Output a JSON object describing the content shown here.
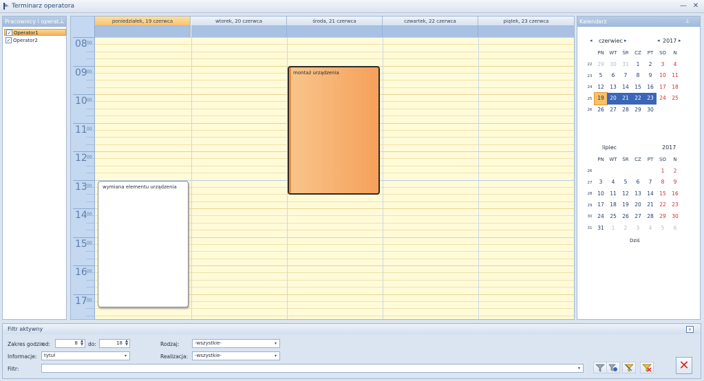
{
  "window": {
    "title": "Terminarz operatora",
    "min_glyph": "—",
    "close_glyph": "✕"
  },
  "left_panel": {
    "title": "Pracownicy i operat...",
    "pin_glyph": "⊥",
    "operators": [
      {
        "label": "Operator1",
        "checked": true,
        "selected": true
      },
      {
        "label": "Operator2",
        "checked": true,
        "selected": false
      }
    ]
  },
  "schedule": {
    "days": [
      {
        "label": "poniedziałek, 19 czerwca",
        "today": true
      },
      {
        "label": "wtorek, 20 czerwca",
        "today": false
      },
      {
        "label": "środa, 21 czerwca",
        "today": false
      },
      {
        "label": "czwartek, 22 czerwca",
        "today": false
      },
      {
        "label": "piątek, 23 czerwca",
        "today": false
      }
    ],
    "hours": [
      "08",
      "09",
      "10",
      "11",
      "12",
      "13",
      "14",
      "15",
      "16",
      "17"
    ],
    "minutes": "00",
    "appointments": [
      {
        "title": "montaż urządzenia",
        "day": "środa, 21 czerwca",
        "start": "09:00",
        "end": "13:30",
        "color": "#f6a864"
      },
      {
        "title": "wymiana elementu urządzenia",
        "day": "poniedziałek, 19 czerwca",
        "start": "13:00",
        "end": "17:30",
        "color": "#ffffff"
      }
    ]
  },
  "calendar": {
    "title": "Kalendarz",
    "weekday_headers": [
      "PN",
      "WT",
      "ŚR",
      "CZ",
      "PT",
      "SO",
      "N"
    ],
    "months": [
      {
        "name": "czerwiec",
        "year": "2017",
        "weeks": [
          "22",
          "23",
          "24",
          "25",
          "26"
        ],
        "days": [
          [
            "29",
            "30",
            "31",
            "1",
            "2",
            "3",
            "4"
          ],
          [
            "5",
            "6",
            "7",
            "8",
            "9",
            "10",
            "11"
          ],
          [
            "12",
            "13",
            "14",
            "15",
            "16",
            "17",
            "18"
          ],
          [
            "19",
            "20",
            "21",
            "22",
            "23",
            "24",
            "25"
          ],
          [
            "26",
            "27",
            "28",
            "29",
            "30",
            "",
            ""
          ]
        ],
        "leading_other": 3,
        "trailing_other": 0
      },
      {
        "name": "lipiec",
        "year": "2017",
        "weeks": [
          "26",
          "27",
          "28",
          "29",
          "30",
          "31"
        ],
        "days": [
          [
            "",
            "",
            "",
            "",
            "",
            "1",
            "2"
          ],
          [
            "3",
            "4",
            "5",
            "6",
            "7",
            "8",
            "9"
          ],
          [
            "10",
            "11",
            "12",
            "13",
            "14",
            "15",
            "16"
          ],
          [
            "17",
            "18",
            "19",
            "20",
            "21",
            "22",
            "23"
          ],
          [
            "24",
            "25",
            "26",
            "27",
            "28",
            "29",
            "30"
          ],
          [
            "31",
            "1",
            "2",
            "3",
            "4",
            "5",
            "6"
          ]
        ]
      }
    ],
    "today_label": "Dziś",
    "selected_range": [
      "19",
      "20",
      "21",
      "22",
      "23"
    ],
    "today_day": "19"
  },
  "filter": {
    "title": "Filtr aktywny",
    "hours_label": "Zakres godzin",
    "from_label": "od:",
    "from_value": "8",
    "to_label": "do:",
    "to_value": "18",
    "info_label": "Informacje:",
    "info_value": "tytuł",
    "kind_label": "Rodzaj:",
    "kind_value": "-wszystkie-",
    "real_label": "Realizacja:",
    "real_value": "-wszystkie-",
    "filter_label": "Filtr:",
    "filter_value": "",
    "collapse_glyph": "»",
    "close_glyph": "✕"
  },
  "colors": {
    "accent": "#3a66b7",
    "today": "#f7c16a",
    "appointment": "#f6a864",
    "close": "#d9261c"
  }
}
